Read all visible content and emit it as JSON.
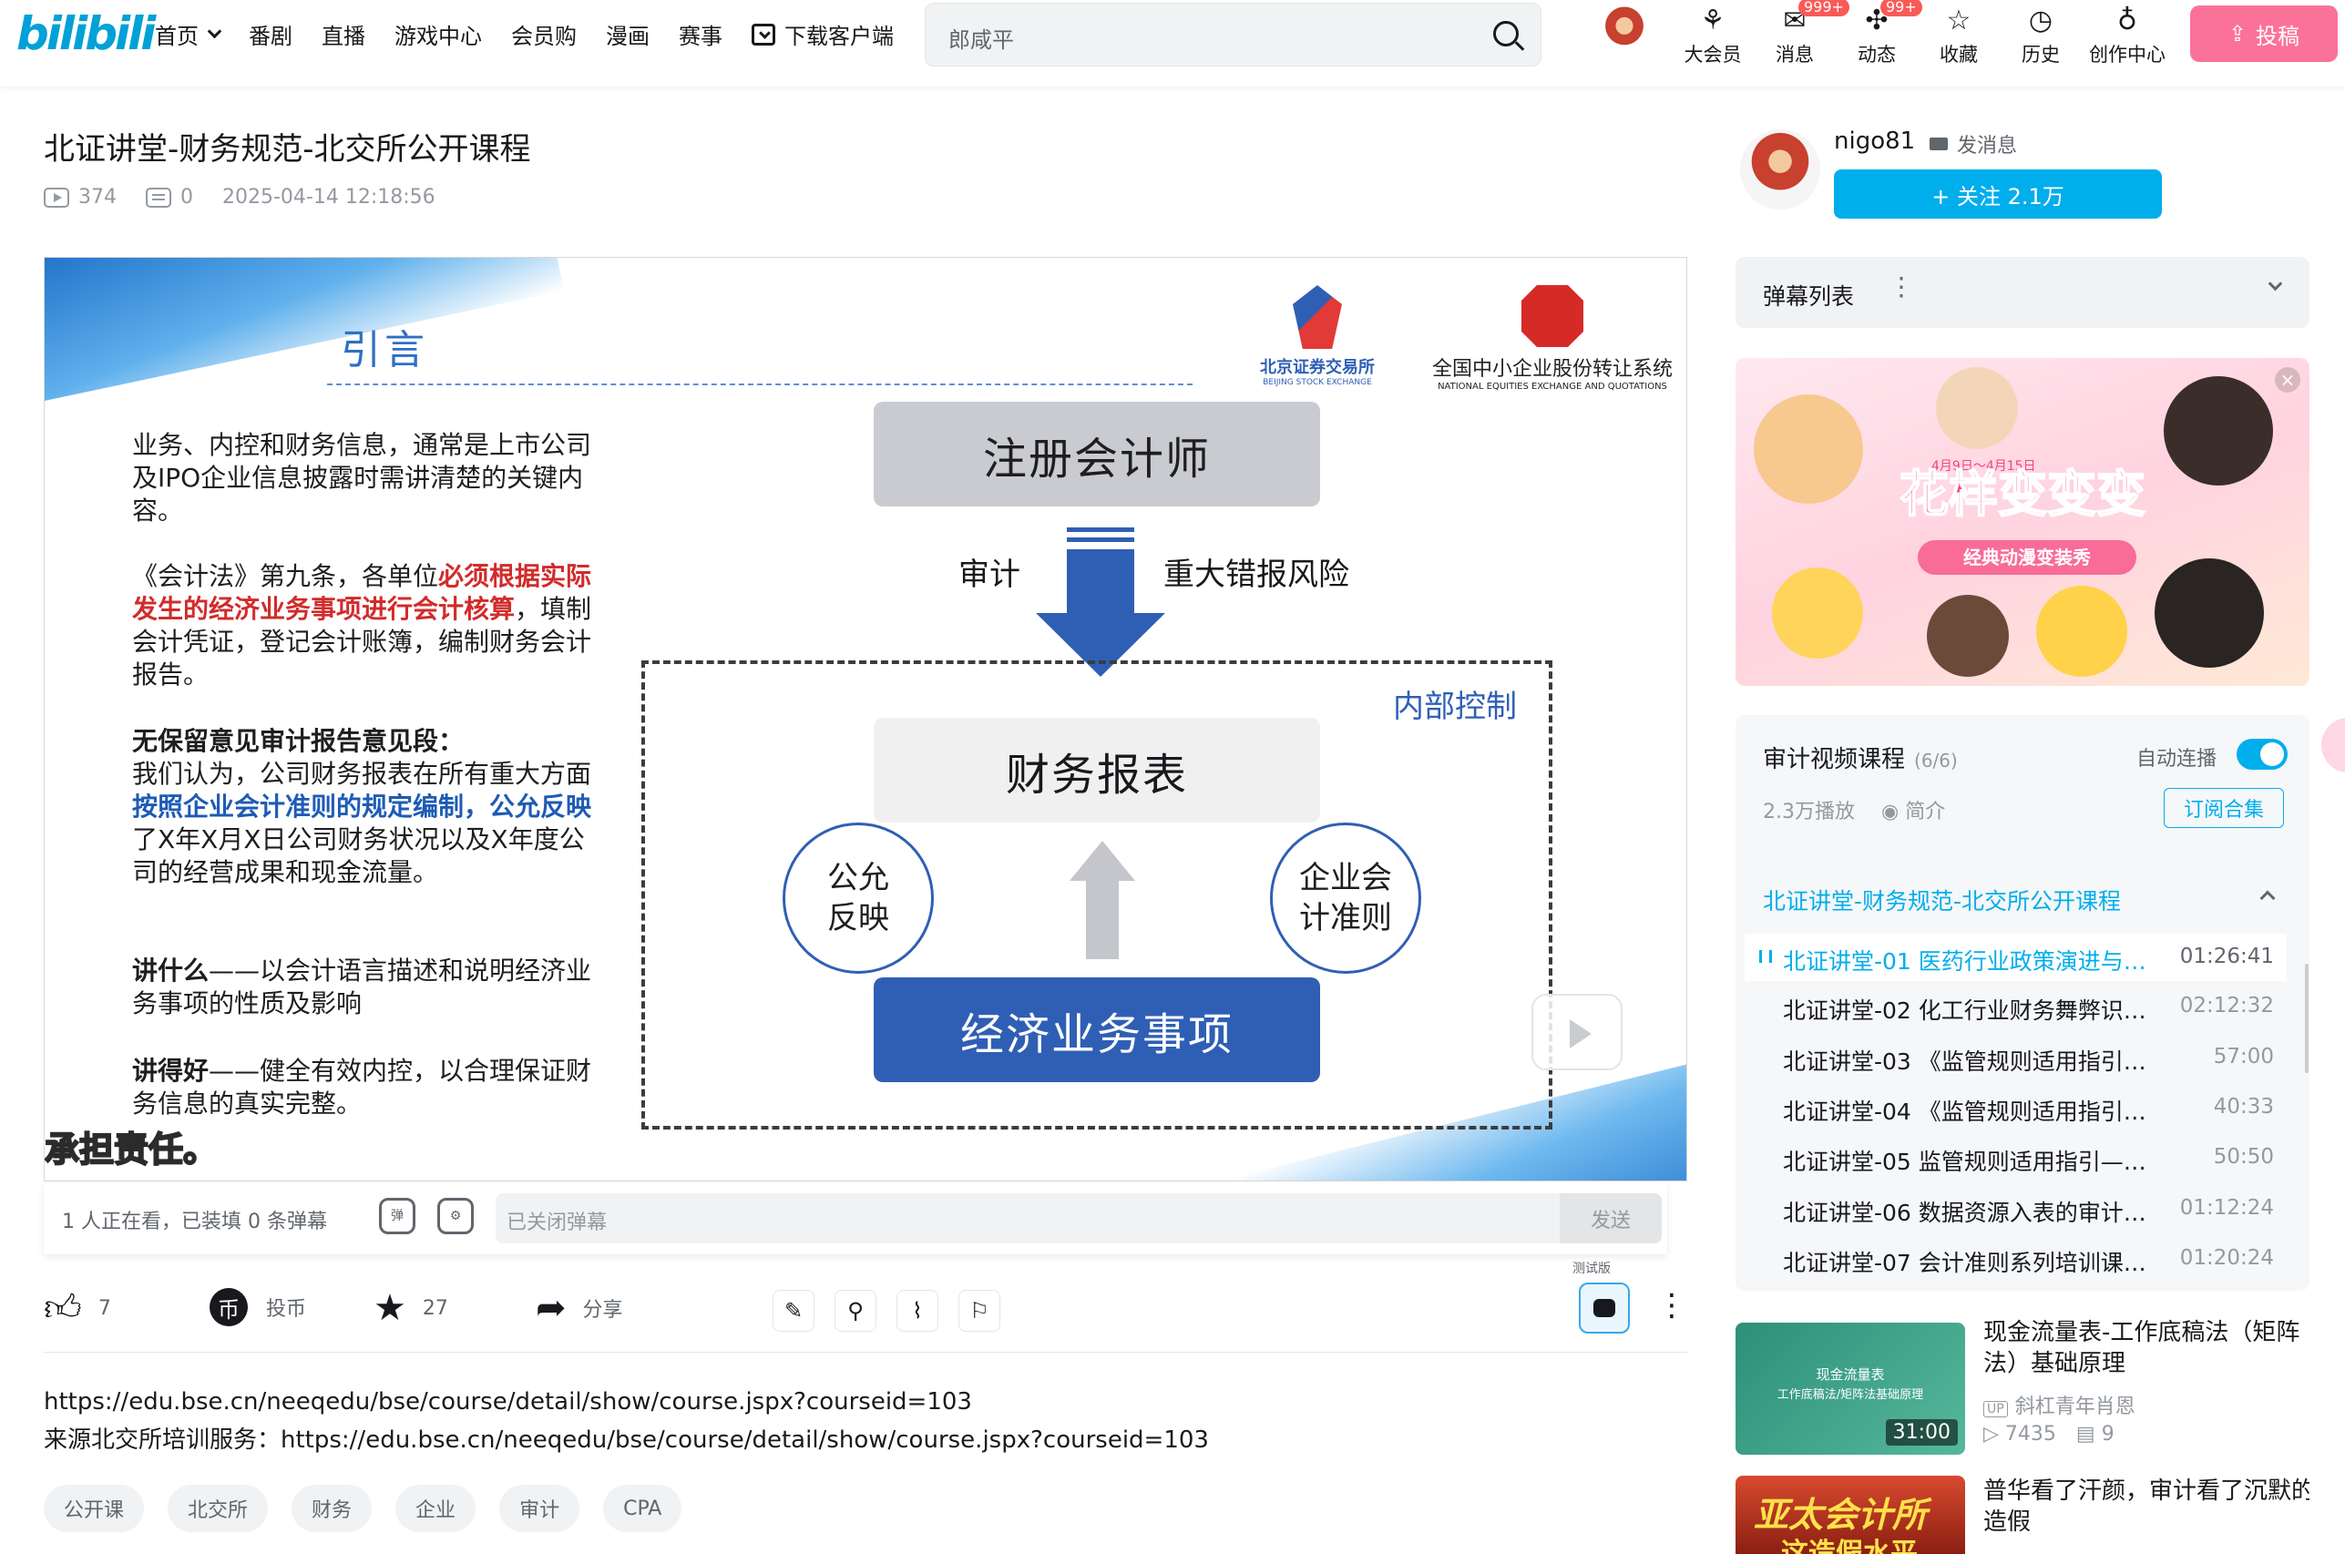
{
  "header": {
    "logo": "bilibili",
    "nav": [
      "首页",
      "番剧",
      "直播",
      "游戏中心",
      "会员购",
      "漫画",
      "赛事",
      "下载客户端"
    ],
    "search_placeholder": "郎咸平",
    "icons": [
      {
        "label": "大会员",
        "icon": "big-member-icon",
        "glyph": "⚘"
      },
      {
        "label": "消息",
        "icon": "message-icon",
        "glyph": "✉",
        "badge": "999+"
      },
      {
        "label": "动态",
        "icon": "dynamic-icon",
        "glyph": "✣",
        "badge": "99+"
      },
      {
        "label": "收藏",
        "icon": "star-icon",
        "glyph": "☆"
      },
      {
        "label": "历史",
        "icon": "history-icon",
        "glyph": "◷"
      },
      {
        "label": "创作中心",
        "icon": "bulb-icon",
        "glyph": "♁"
      }
    ],
    "upload_label": "投稿"
  },
  "video": {
    "title": "北证讲堂-财务规范-北交所公开课程",
    "views": "374",
    "danmaku_count": "0",
    "date": "2025-04-14 12:18:56"
  },
  "slide": {
    "heading": "引言",
    "logo_bse_cn": "北京证券交易所",
    "logo_bse_en": "BEIJING STOCK EXCHANGE",
    "logo_neeq_cn": "全国中小企业股份转让系统",
    "logo_neeq_en": "NATIONAL EQUITIES EXCHANGE AND QUOTATIONS",
    "p1": "业务、内控和财务信息，通常是上市公司及IPO企业信息披露时需讲清楚的关键内容。",
    "p2_a": "《会计法》第九条，各单位",
    "p2_red": "必须根据实际发生的经济业务事项进行会计核算",
    "p2_b": "，填制会计凭证，登记会计账簿，编制财务会计报告。",
    "p3_title": "无保留意见审计报告意见段：",
    "p3_a": "我们认为，公司财务报表在所有重大方面",
    "p3_blue": "按照企业会计准则的规定编制，公允反映",
    "p3_b": "了X年X月X日公司财务状况以及X年度公司的经营成果和现金流量。",
    "p4_b": "讲什么",
    "p4": "——以会计语言描述和说明经济业务事项的性质及影响",
    "p5_b": "讲得好",
    "p5": "——健全有效内控，以合理保证财务信息的真实完整。",
    "cpa": "注册会计师",
    "audit": "审计",
    "risk": "重大错报风险",
    "internal_control": "内部控制",
    "financial_statements": "财务报表",
    "fair": "公允反映",
    "standards": "企业会计准则",
    "economic": "经济业务事项",
    "subtitle": "承担责任。"
  },
  "danmaku_bar": {
    "watching": "1 人正在看，已装填 0 条弹幕",
    "placeholder": "已关闭弹幕",
    "send": "发送"
  },
  "actions": {
    "like": "7",
    "coin": "投币",
    "favorite": "27",
    "share": "分享",
    "beta_tag": "测试版"
  },
  "description": {
    "line1": "https://edu.bse.cn/neeqedu/bse/course/detail/show/course.jspx?courseid=103",
    "line2": "来源北交所培训服务：https://edu.bse.cn/neeqedu/bse/course/detail/show/course.jspx?courseid=103"
  },
  "tags": [
    "公开课",
    "北交所",
    "财务",
    "企业",
    "审计",
    "CPA"
  ],
  "uploader": {
    "name": "nigo81",
    "message": "发消息",
    "follow": "+ 关注 2.1万"
  },
  "danmaku_list": {
    "title": "弹幕列表"
  },
  "banner": {
    "date": "4月9日～4月15日",
    "title": "花样变变变",
    "subtitle": "经典动漫变装秀",
    "close": "×"
  },
  "course": {
    "title": "审计视频课程",
    "count": "(6/6)",
    "autoplay": "自动连播",
    "plays": "2.3万播放",
    "intro": "简介",
    "subscribe": "订阅合集",
    "section": "北证讲堂-财务规范-北交所公开课程",
    "episodes": [
      {
        "name": "北证讲堂-01 医药行业政策演进与财务问题",
        "duration": "01:26:41"
      },
      {
        "name": "北证讲堂-02 化工行业财务舞弊识别与防范",
        "duration": "02:12:32"
      },
      {
        "name": "北证讲堂-03 《监管规则适用指引——发行类》",
        "duration": "57:00"
      },
      {
        "name": "北证讲堂-04 《监管规则适用指引——会计类》",
        "duration": "40:33"
      },
      {
        "name": "北证讲堂-05 监管规则适用指引——审计类",
        "duration": "50:50"
      },
      {
        "name": "北证讲堂-06 数据资源入表的审计与关注",
        "duration": "01:12:24"
      },
      {
        "name": "北证讲堂-07 会计准则系列培训课程讲解",
        "duration": "01:20:24"
      }
    ]
  },
  "recommendations": [
    {
      "title": "现金流量表-工作底稿法（矩阵法）基础原理",
      "thumb_title": "现金流量表",
      "thumb_sub": "工作底稿法/矩阵法基础原理",
      "duration": "31:00",
      "uploader": "斜杠青年肖恩",
      "views": "7435",
      "danmaku": "9"
    },
    {
      "title": "普华看了汗颜，审计看了沉默的造假",
      "thumb_title": "亚太会计所",
      "thumb_sub": "这造假水平"
    }
  ]
}
